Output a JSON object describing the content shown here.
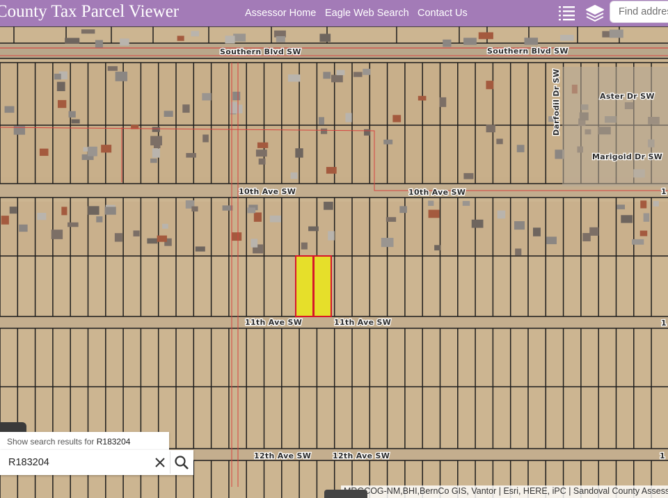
{
  "header": {
    "title": "County Tax Parcel Viewer",
    "nav": [
      "Assessor Home",
      "Eagle Web Search",
      "Contact Us"
    ],
    "find_placeholder": "Find address"
  },
  "map": {
    "roads": {
      "southern_blvd": "Southern Blvd SW",
      "aster": "Aster Dr SW",
      "darfodil": "Darfodil Dr SW",
      "marigold": "Marigold Dr SW",
      "tenth_ave": "10th Ave SW",
      "eleventh_ave": "11th Ave SW",
      "twelfth_ave": "12th Ave SW"
    },
    "edge_labels": {
      "right_10th": "1",
      "right_11th": "1",
      "right_12th": "1"
    },
    "highlight_color": "#e6df2a",
    "highlight_border": "#d6162a"
  },
  "search": {
    "suggestion_prefix": "Show search results for",
    "suggestion_term": "R183204",
    "value": "R183204"
  },
  "attribution": "MRGCOG-NM,BHI,BernCo GIS, Vantor | Esri, HERE, iPC | Sandoval County Assessor"
}
